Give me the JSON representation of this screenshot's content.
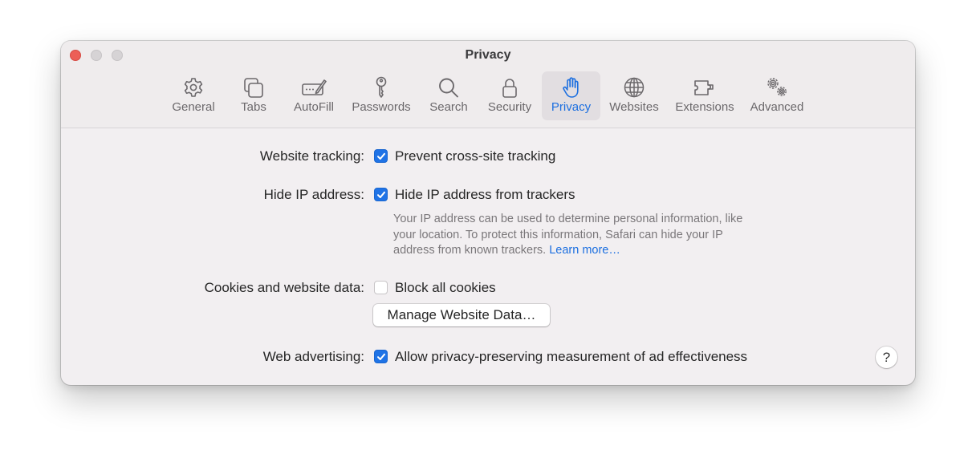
{
  "window": {
    "title": "Privacy"
  },
  "toolbar": {
    "items": [
      {
        "label": "General",
        "icon": "gear-icon"
      },
      {
        "label": "Tabs",
        "icon": "tabs-icon"
      },
      {
        "label": "AutoFill",
        "icon": "autofill-pen-icon"
      },
      {
        "label": "Passwords",
        "icon": "key-icon"
      },
      {
        "label": "Search",
        "icon": "magnifier-icon"
      },
      {
        "label": "Security",
        "icon": "lock-icon"
      },
      {
        "label": "Privacy",
        "icon": "hand-icon",
        "selected": true
      },
      {
        "label": "Websites",
        "icon": "globe-icon"
      },
      {
        "label": "Extensions",
        "icon": "puzzle-icon"
      },
      {
        "label": "Advanced",
        "icon": "gears-icon"
      }
    ]
  },
  "settings": {
    "website_tracking": {
      "label": "Website tracking:",
      "checkbox_label": "Prevent cross-site tracking",
      "checked": true
    },
    "hide_ip": {
      "label": "Hide IP address:",
      "checkbox_label": "Hide IP address from trackers",
      "checked": true,
      "help_line1": "Your IP address can be used to determine personal information, like",
      "help_line2": "your location. To protect this information, Safari can hide your IP",
      "help_line3": "address from known trackers.",
      "learn_more": "Learn more…"
    },
    "cookies": {
      "label": "Cookies and website data:",
      "checkbox_label": "Block all cookies",
      "checked": false,
      "button_label": "Manage Website Data…"
    },
    "web_advertising": {
      "label": "Web advertising:",
      "checkbox_label": "Allow privacy-preserving measurement of ad effectiveness",
      "checked": true
    }
  },
  "help_button": {
    "label": "?"
  },
  "colors": {
    "accent": "#1f73e6",
    "close": "#ec5f57",
    "window_bg": "#f2eff1"
  }
}
